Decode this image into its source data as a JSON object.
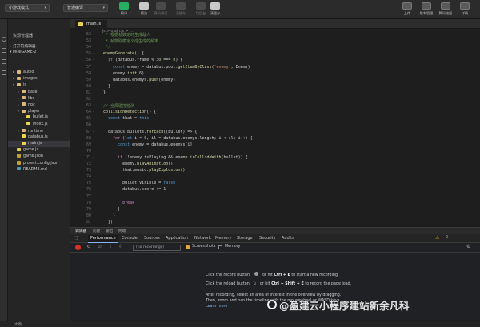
{
  "toolbar": {
    "mode_select": "小游戏模式",
    "compile_select": "普通编译",
    "buttons": [
      {
        "label": "编译",
        "icon": "compile-icon",
        "color": "#27ae60"
      },
      {
        "label": "预览",
        "icon": "preview-icon",
        "color": "#c8c8c8"
      },
      {
        "label": "真机调试",
        "icon": "debug-icon",
        "color": "#4a4a4a"
      },
      {
        "label": "清缓存",
        "icon": "clear-cache-icon",
        "color": "#4a4a4a"
      },
      {
        "label": "切后台",
        "icon": "background-icon",
        "color": "#4a4a4a"
      },
      {
        "label": "清缓存",
        "icon": "clear-cache-icon-2",
        "color": "#c8c8c8"
      }
    ],
    "right_buttons": [
      {
        "label": "上传",
        "icon": "upload-icon"
      },
      {
        "label": "版本管理",
        "icon": "version-icon"
      },
      {
        "label": "腾讯地图",
        "icon": "tencent-map-icon"
      },
      {
        "label": "详情",
        "icon": "details-icon"
      }
    ]
  },
  "sidebar": {
    "title": "资源管理器",
    "open_editors": "打开的编辑器",
    "project": "MINIGAME-2",
    "tree": [
      {
        "label": "audio",
        "type": "folder",
        "depth": 1,
        "arrow": "▸"
      },
      {
        "label": "images",
        "type": "folder",
        "depth": 1,
        "arrow": "▸"
      },
      {
        "label": "js",
        "type": "folder",
        "depth": 1,
        "arrow": "▾"
      },
      {
        "label": "base",
        "type": "folder",
        "depth": 2,
        "arrow": "▸"
      },
      {
        "label": "libs",
        "type": "folder",
        "depth": 2,
        "arrow": "▸"
      },
      {
        "label": "npc",
        "type": "folder",
        "depth": 2,
        "arrow": "▸"
      },
      {
        "label": "player",
        "type": "folder",
        "depth": 2,
        "arrow": "▾"
      },
      {
        "label": "bullet.js",
        "type": "js",
        "depth": 3,
        "arrow": ""
      },
      {
        "label": "index.js",
        "type": "js",
        "depth": 3,
        "arrow": ""
      },
      {
        "label": "runtime",
        "type": "folder",
        "depth": 2,
        "arrow": "▸"
      },
      {
        "label": "databus.js",
        "type": "js",
        "depth": 2,
        "arrow": ""
      },
      {
        "label": "main.js",
        "type": "js",
        "depth": 2,
        "arrow": "",
        "selected": true
      },
      {
        "label": "game.js",
        "type": "js",
        "depth": 1,
        "arrow": ""
      },
      {
        "label": "game.json",
        "type": "json",
        "depth": 1,
        "arrow": ""
      },
      {
        "label": "project.config.json",
        "type": "json",
        "depth": 1,
        "arrow": ""
      },
      {
        "label": "README.md",
        "type": "md",
        "depth": 1,
        "arrow": ""
      }
    ]
  },
  "editor": {
    "tab": "main.js",
    "breadcrumb": "js > main.js > ...",
    "lines": [
      {
        "n": "",
        "html": "<span style='color:#6a9955'> * 根据帧数定时生成敌人</span>"
      },
      {
        "n": "",
        "html": "<span style='color:#6a9955'> * 帧数取模定义成生成的频率</span>"
      },
      {
        "n": "",
        "html": "<span style='color:#6a9955'> */</span>"
      },
      {
        "n": "",
        "fold": "▾",
        "html": "<span style='color:#dcdcaa'>enemyGenerate</span>() {"
      },
      {
        "n": "",
        "fold": "▾",
        "html": "  <span style='color:#c586c0'>if</span> (databus.frame <span style='color:#d4d4d4'>%</span> <span style='color:#b5cea8'>30</span> === <span style='color:#b5cea8'>0</span>) {"
      },
      {
        "n": "",
        "html": "    <span style='color:#569cd6'>const</span> enemy = databus.pool.<span style='color:#dcdcaa'>getItemByClass</span>(<span style='color:#ce9178'>'enemy'</span>, Enemy)"
      },
      {
        "n": "",
        "html": "    enemy.<span style='color:#dcdcaa'>init</span>(<span style='color:#b5cea8'>6</span>)"
      },
      {
        "n": "",
        "html": "    databus.enemys.<span style='color:#dcdcaa'>push</span>(enemy)"
      },
      {
        "n": "",
        "html": "  }"
      },
      {
        "n": "",
        "html": "}"
      },
      {
        "n": "",
        "html": ""
      },
      {
        "n": "",
        "html": "<span style='color:#6a9955'>// 全局碰撞检测</span>"
      },
      {
        "n": "",
        "fold": "▾",
        "html": "<span style='color:#dcdcaa'>collisionDetection</span>() {"
      },
      {
        "n": "",
        "html": "  <span style='color:#569cd6'>const</span> that = <span style='color:#569cd6'>this</span>"
      },
      {
        "n": "",
        "html": ""
      },
      {
        "n": "",
        "fold": "▾",
        "html": "  databus.bullets.<span style='color:#dcdcaa'>forEach</span>((bullet) => {"
      },
      {
        "n": "",
        "fold": "▾",
        "html": "    <span style='color:#c586c0'>for</span> (<span style='color:#569cd6'>let</span> i = <span style='color:#b5cea8'>0</span>, il = databus.enemys.length; i &lt; il; i++) {"
      },
      {
        "n": "",
        "html": "      <span style='color:#569cd6'>const</span> enemy = databus.enemys[i]"
      },
      {
        "n": "",
        "html": ""
      },
      {
        "n": "",
        "fold": "▾",
        "html": "      <span style='color:#c586c0'>if</span> (!enemy.isPlaying &amp;&amp; enemy.<span style='color:#dcdcaa'>isCollideWith</span>(bullet)) {"
      },
      {
        "n": "",
        "html": "        enemy.<span style='color:#dcdcaa'>playAnimation</span>()"
      },
      {
        "n": "",
        "html": "        that.music.<span style='color:#dcdcaa'>playExplosion</span>()"
      },
      {
        "n": "",
        "html": ""
      },
      {
        "n": "",
        "html": "        bullet.visible = <span style='color:#569cd6'>false</span>"
      },
      {
        "n": "",
        "html": "        databus.score += <span style='color:#b5cea8'>1</span>"
      },
      {
        "n": "",
        "html": ""
      },
      {
        "n": "",
        "html": "        <span style='color:#c586c0'>break</span>"
      },
      {
        "n": "",
        "html": "      }"
      },
      {
        "n": "",
        "html": "    }"
      },
      {
        "n": "",
        "html": "  })"
      }
    ]
  },
  "devtools": {
    "outer_tabs": [
      "调试器",
      "问题",
      "输出",
      "终端"
    ],
    "tabs": [
      "Performance",
      "Console",
      "Sources",
      "Application",
      "Network",
      "Memory",
      "Storage",
      "Security",
      "Audits"
    ],
    "active_tab": "Performance",
    "recording_select": "(no recordings)",
    "screenshots": "Screenshots",
    "memory": "Memory",
    "msg_record_a": "Click the record button",
    "msg_record_b": "or hit",
    "msg_record_key": "Ctrl + E",
    "msg_record_c": "to start a new recording.",
    "msg_reload_a": "Click the reload button",
    "msg_reload_b": "or hit",
    "msg_reload_key": "Ctrl + Shift + E",
    "msg_reload_c": "to record the page load.",
    "msg_after_1": "After recording, select an area of interest in the overview by dragging.",
    "msg_after_2": "Then, zoom and pan the timeline with the mousewheel or WASD keys.",
    "learn_more": "Learn more"
  },
  "status": {
    "outline": "大纲"
  },
  "watermark": "@盈建云小程序建站新余凡科"
}
